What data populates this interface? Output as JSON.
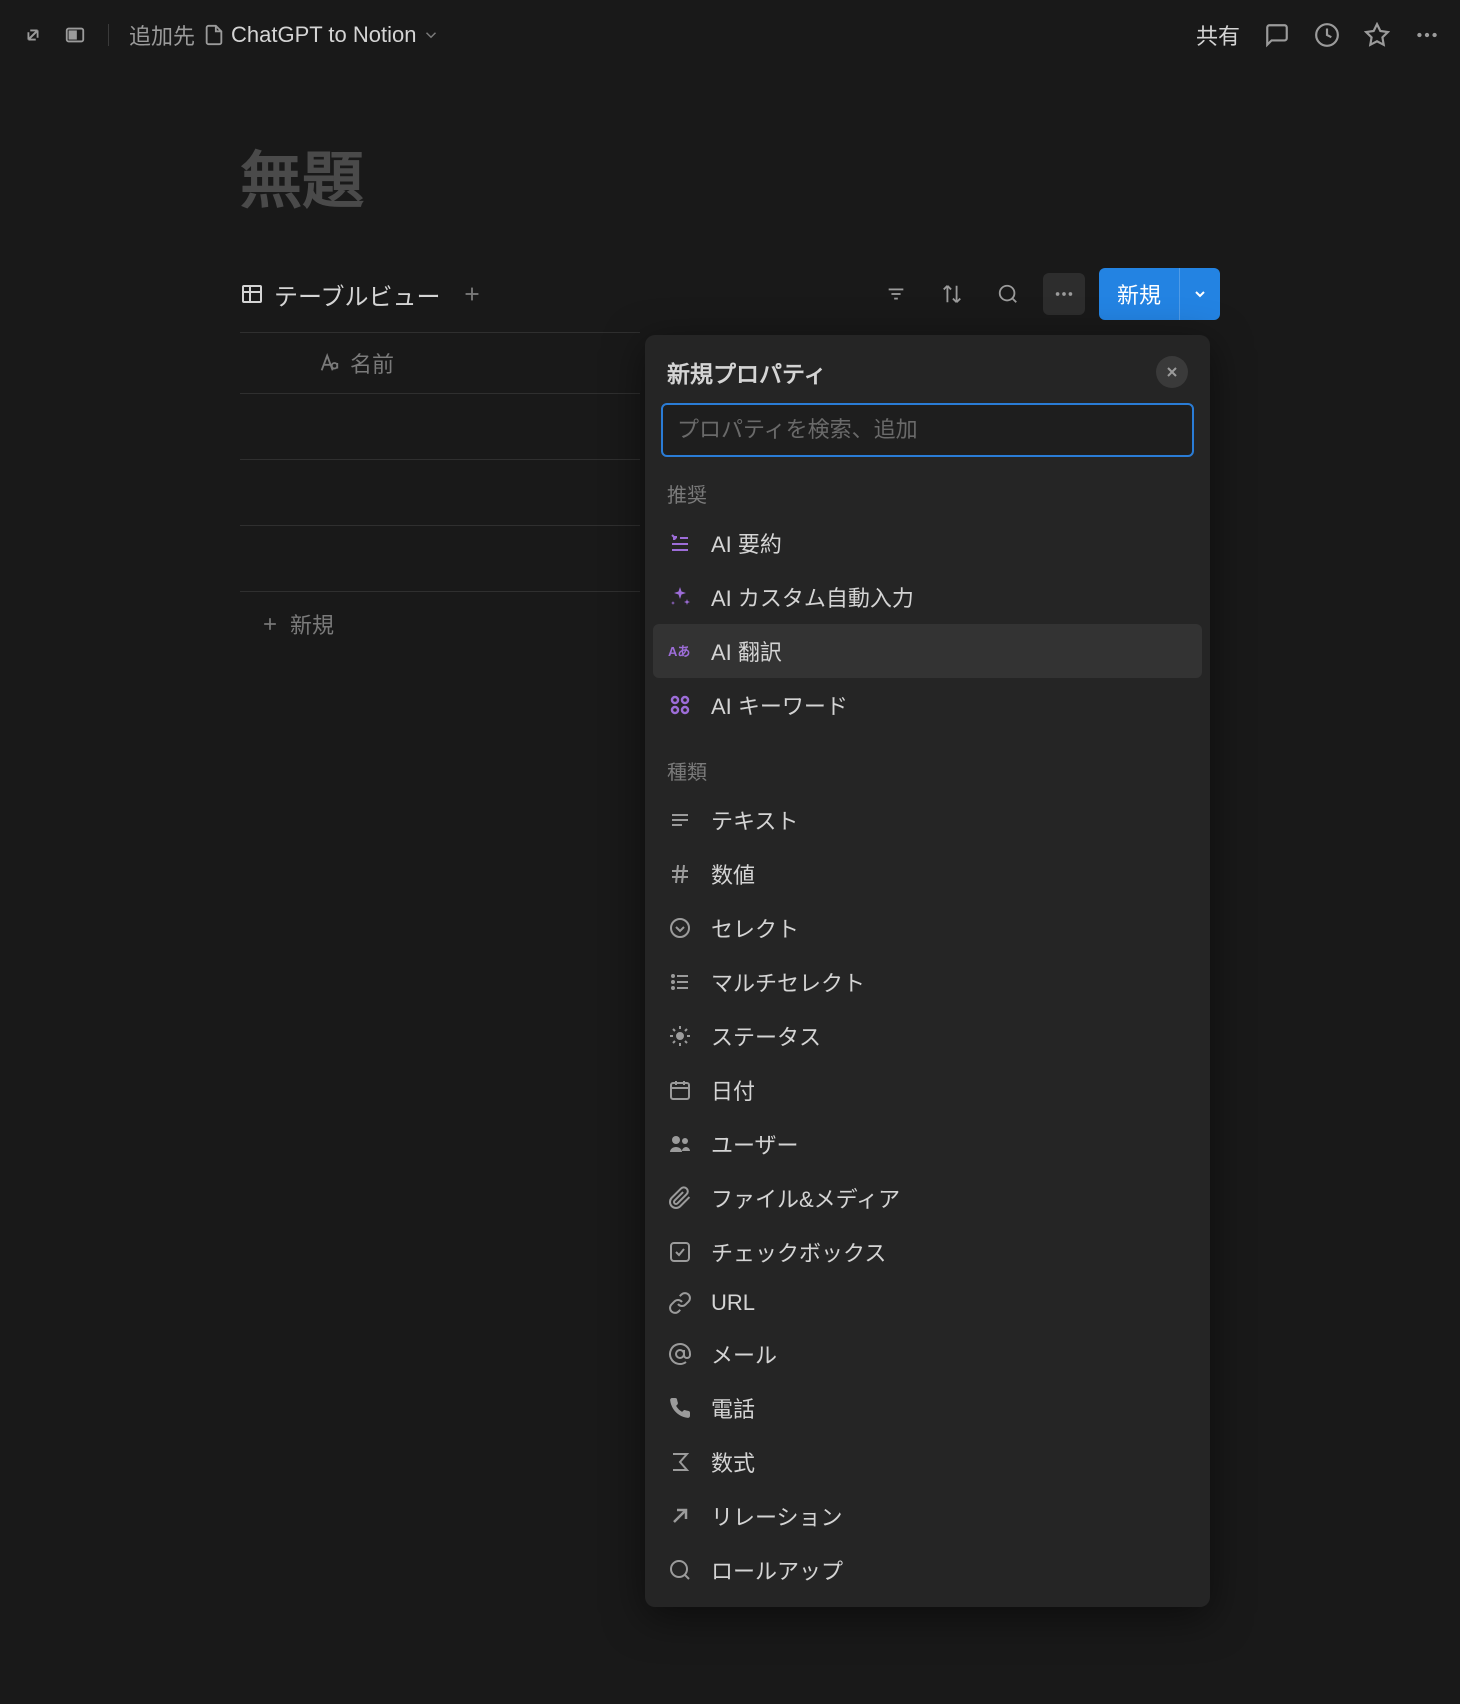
{
  "topbar": {
    "add_to_label": "追加先",
    "page_title": "ChatGPT to Notion",
    "share_label": "共有"
  },
  "page": {
    "title": "無題"
  },
  "database": {
    "view_label": "テーブルビュー",
    "new_label": "新規",
    "column_name": "名前",
    "add_row_label": "新規"
  },
  "popover": {
    "title": "新規プロパティ",
    "search_placeholder": "プロパティを検索、追加",
    "section_recommended": "推奨",
    "section_types": "種類",
    "recommended": [
      {
        "label": "AI 要約"
      },
      {
        "label": "AI カスタム自動入力"
      },
      {
        "label": "AI 翻訳"
      },
      {
        "label": "AI キーワード"
      }
    ],
    "types": [
      {
        "label": "テキスト"
      },
      {
        "label": "数値"
      },
      {
        "label": "セレクト"
      },
      {
        "label": "マルチセレクト"
      },
      {
        "label": "ステータス"
      },
      {
        "label": "日付"
      },
      {
        "label": "ユーザー"
      },
      {
        "label": "ファイル&メディア"
      },
      {
        "label": "チェックボックス"
      },
      {
        "label": "URL"
      },
      {
        "label": "メール"
      },
      {
        "label": "電話"
      },
      {
        "label": "数式"
      },
      {
        "label": "リレーション"
      },
      {
        "label": "ロールアップ"
      }
    ]
  }
}
